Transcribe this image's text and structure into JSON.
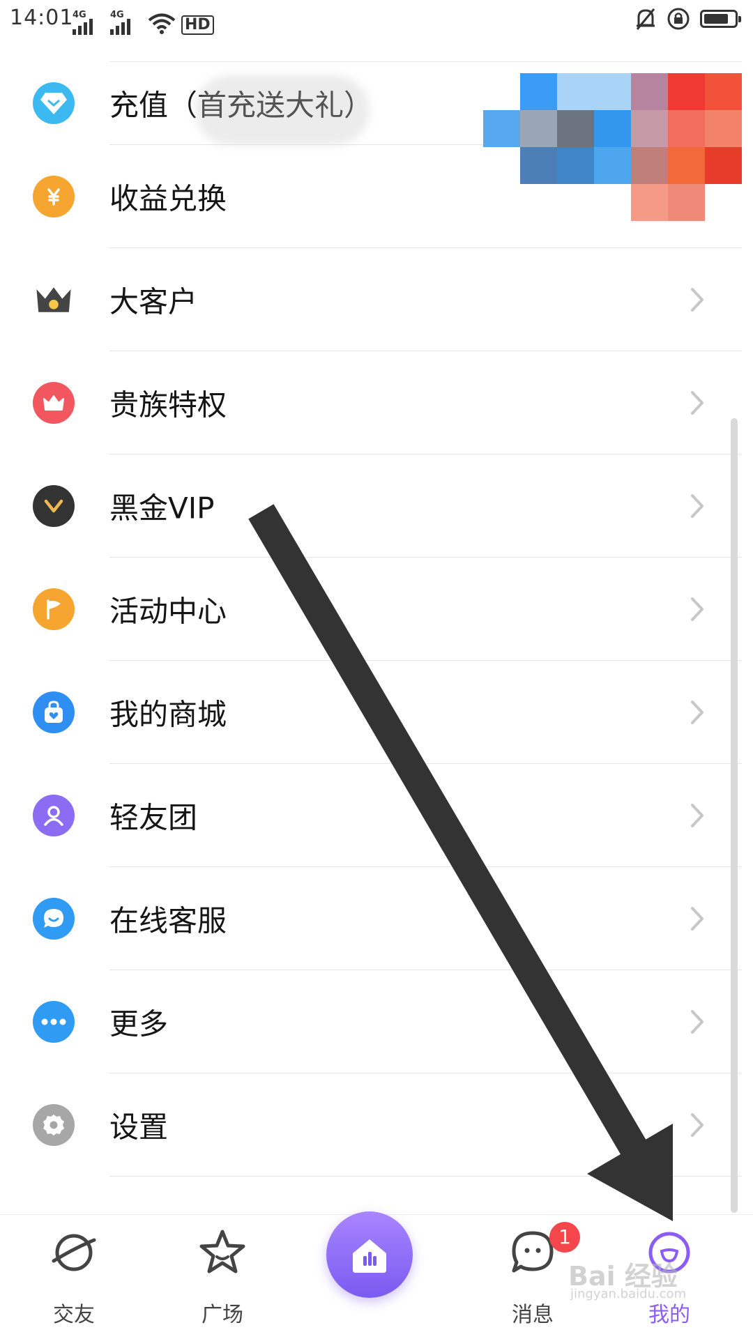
{
  "status_bar": {
    "time": "14:01",
    "network_1": "4G",
    "network_2": "4G",
    "hd_label": "HD",
    "battery_level": 0.8
  },
  "menu": {
    "items": [
      {
        "label": "充值（首充送大礼）",
        "icon": "diamond-icon",
        "color": "#3db9f2"
      },
      {
        "label": "收益兑换",
        "icon": "yuan-coin-icon",
        "color": "#f7a531"
      },
      {
        "label": "大客户",
        "icon": "crown-dark-icon",
        "color": "#333333"
      },
      {
        "label": "贵族特权",
        "icon": "crown-icon",
        "color": "#f2565e"
      },
      {
        "label": "黑金VIP",
        "icon": "vip-v-icon",
        "color": "#333333"
      },
      {
        "label": "活动中心",
        "icon": "flag-icon",
        "color": "#f7a531"
      },
      {
        "label": "我的商城",
        "icon": "shopping-bag-icon",
        "color": "#2f8ef2"
      },
      {
        "label": "轻友团",
        "icon": "user-icon",
        "color": "#8b6cf2"
      },
      {
        "label": "在线客服",
        "icon": "chat-bubble-icon",
        "color": "#2f9bf2"
      },
      {
        "label": "更多",
        "icon": "more-dots-icon",
        "color": "#2f9bf2"
      },
      {
        "label": "设置",
        "icon": "gear-icon",
        "color": "#a7a7a7"
      }
    ]
  },
  "bottom_nav": {
    "items": [
      {
        "label": "交友",
        "icon": "planet-icon"
      },
      {
        "label": "广场",
        "icon": "star-icon"
      },
      {
        "label": "",
        "icon": "home-center-icon"
      },
      {
        "label": "消息",
        "icon": "message-icon",
        "badge": "1"
      },
      {
        "label": "我的",
        "icon": "profile-icon",
        "active": true
      }
    ],
    "active_color": "#8b5cf6"
  },
  "watermark": {
    "brand": "Bai 经验",
    "url": "jingyan.baidu.com"
  }
}
